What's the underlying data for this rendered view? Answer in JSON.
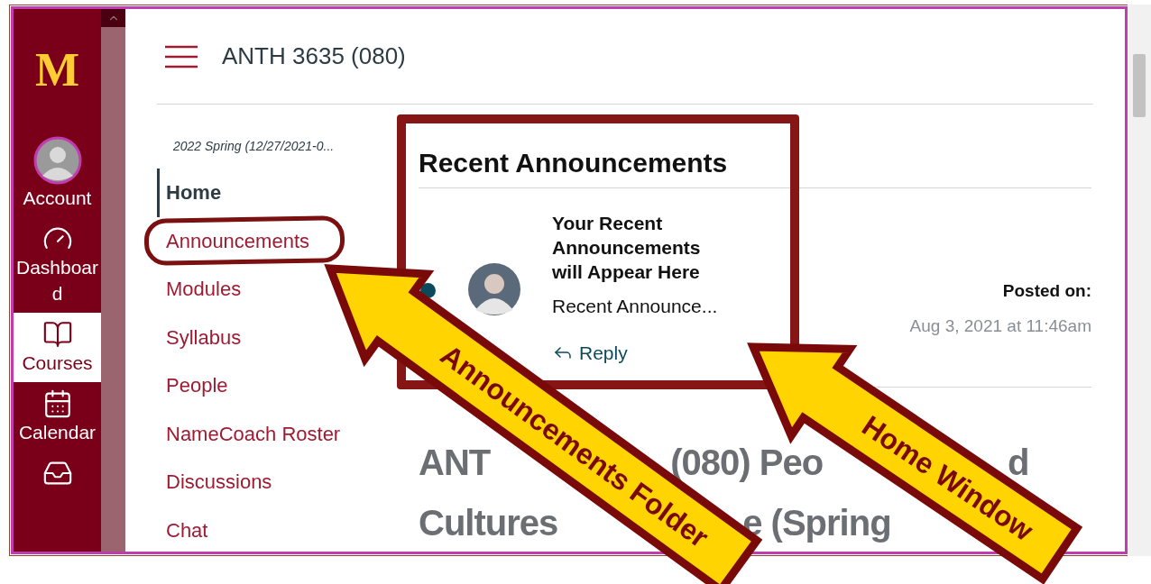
{
  "global_nav": {
    "logo_text": "M",
    "items": [
      {
        "kind": "account",
        "label": "Account",
        "selected": false
      },
      {
        "kind": "dashboard",
        "label": "Dashboard",
        "selected": false
      },
      {
        "kind": "courses",
        "label": "Courses",
        "selected": true
      },
      {
        "kind": "calendar",
        "label": "Calendar",
        "selected": false
      },
      {
        "kind": "inbox",
        "selected": false
      }
    ]
  },
  "header": {
    "title": "ANTH 3635 (080)"
  },
  "course_nav": {
    "term": "2022 Spring (12/27/2021-0...",
    "items": [
      {
        "label": "Home",
        "selected": true
      },
      {
        "label": "Announcements",
        "selected": false
      },
      {
        "label": "Modules",
        "selected": false
      },
      {
        "label": "Syllabus",
        "selected": false
      },
      {
        "label": "People",
        "selected": false
      },
      {
        "label": "NameCoach Roster",
        "selected": false
      },
      {
        "label": "Discussions",
        "selected": false
      },
      {
        "label": "Chat",
        "selected": false
      }
    ]
  },
  "recent_announcements": {
    "title": "Recent Announcements",
    "items": [
      {
        "unread": true,
        "title": "Your Recent Announcements will Appear Here",
        "snippet": "Recent Announce...",
        "reply": "Reply",
        "posted_label": "Posted on:",
        "posted_date": "Aug 3, 2021 at 11:46am"
      }
    ]
  },
  "course_heading_fragments": [
    [
      "ANT",
      "(080) Peo",
      "d"
    ],
    [
      "Cultures",
      "e (Spring"
    ]
  ],
  "annotations": [
    {
      "kind": "oval"
    },
    {
      "kind": "frame"
    },
    {
      "kind": "arrow",
      "label": "Announcements Folder"
    },
    {
      "kind": "arrow",
      "label": "Home Window"
    }
  ]
}
